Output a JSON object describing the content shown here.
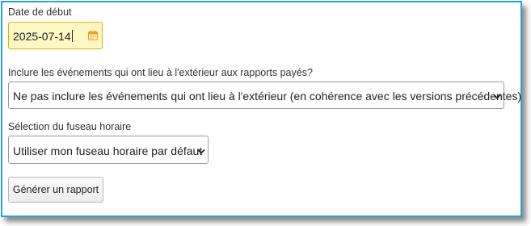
{
  "form": {
    "start_date": {
      "label": "Date de début",
      "value": "2025-07-14",
      "icon": "calendar-icon"
    },
    "outdoor_events": {
      "label": "Inclure les événements qui ont lieu à l'extérieur aux rapports payés?",
      "selected": "Ne pas inclure les événements qui ont lieu à l'extérieur (en cohérence avec les versions précédentes)"
    },
    "timezone": {
      "label": "Sélection du fuseau horaire",
      "selected": "Utiliser mon fuseau horaire par défaut"
    },
    "generate_button": {
      "label": "Générer un rapport"
    }
  },
  "colors": {
    "frame_border": "#2aa0d8",
    "date_field_bg": "#fdf7c6",
    "date_field_border": "#e7b100",
    "calendar_icon": "#f0a020"
  }
}
